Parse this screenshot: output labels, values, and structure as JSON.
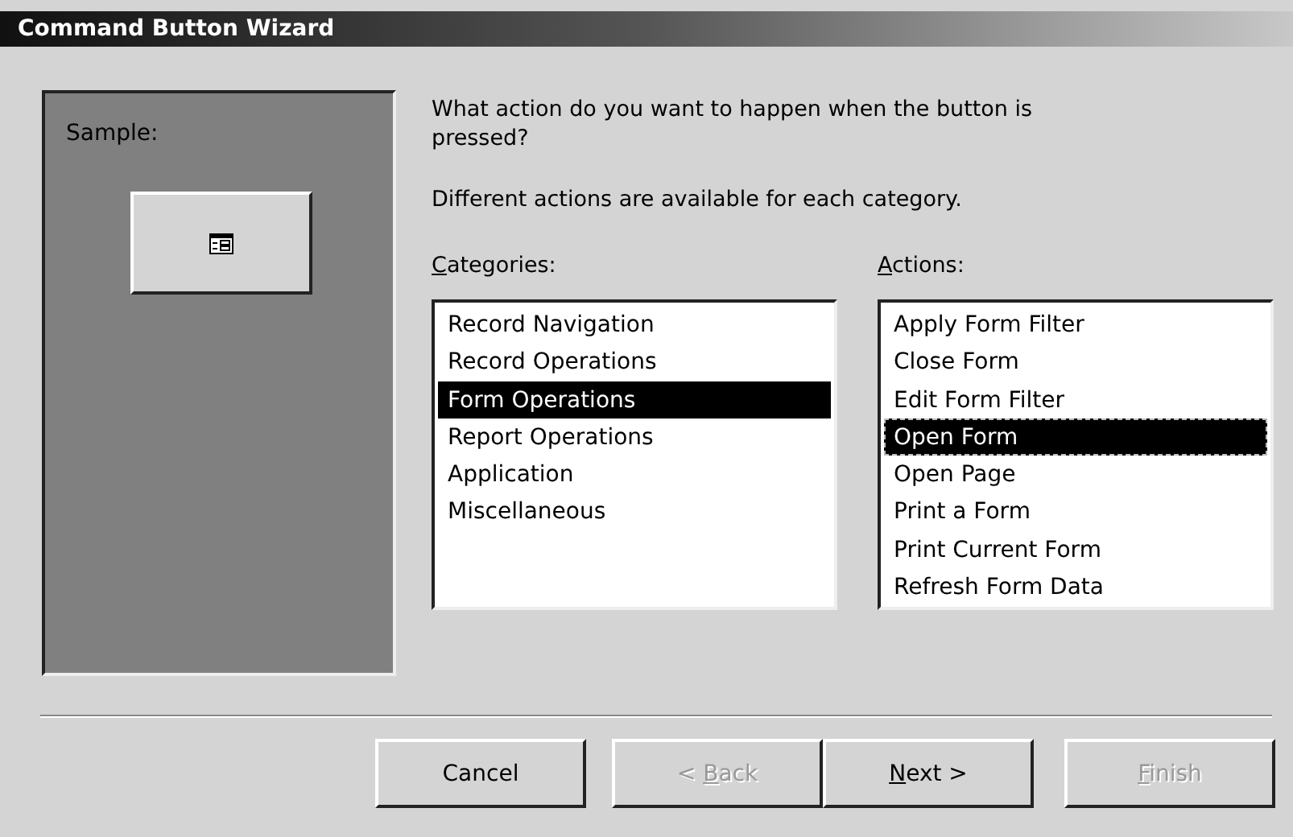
{
  "window": {
    "title": "Command Button Wizard"
  },
  "sample": {
    "label": "Sample:"
  },
  "question": "What action do you want to happen when the button is pressed?",
  "hint": "Different actions are available for each category.",
  "lists": [
    {
      "label": {
        "key": "C",
        "post": "ategories:"
      },
      "focused": false,
      "items": [
        {
          "text": "Record Navigation",
          "selected": false
        },
        {
          "text": "Record Operations",
          "selected": false
        },
        {
          "text": "Form Operations",
          "selected": true
        },
        {
          "text": "Report Operations",
          "selected": false
        },
        {
          "text": "Application",
          "selected": false
        },
        {
          "text": "Miscellaneous",
          "selected": false
        }
      ]
    },
    {
      "label": {
        "key": "A",
        "post": "ctions:"
      },
      "focused": true,
      "items": [
        {
          "text": "Apply Form Filter",
          "selected": false
        },
        {
          "text": "Close Form",
          "selected": false
        },
        {
          "text": "Edit Form Filter",
          "selected": false
        },
        {
          "text": "Open Form",
          "selected": true
        },
        {
          "text": "Open Page",
          "selected": false
        },
        {
          "text": "Print a Form",
          "selected": false
        },
        {
          "text": "Print Current Form",
          "selected": false
        },
        {
          "text": "Refresh Form Data",
          "selected": false
        }
      ]
    }
  ],
  "buttons": [
    {
      "label": {
        "pre": "Cancel"
      },
      "disabled": false
    },
    {
      "label": {
        "pre": "< ",
        "key": "B",
        "post": "ack"
      },
      "disabled": true
    },
    {
      "label": {
        "key": "N",
        "post": "ext >"
      },
      "disabled": false
    },
    {
      "label": {
        "key": "F",
        "post": "inish"
      },
      "disabled": true
    }
  ]
}
